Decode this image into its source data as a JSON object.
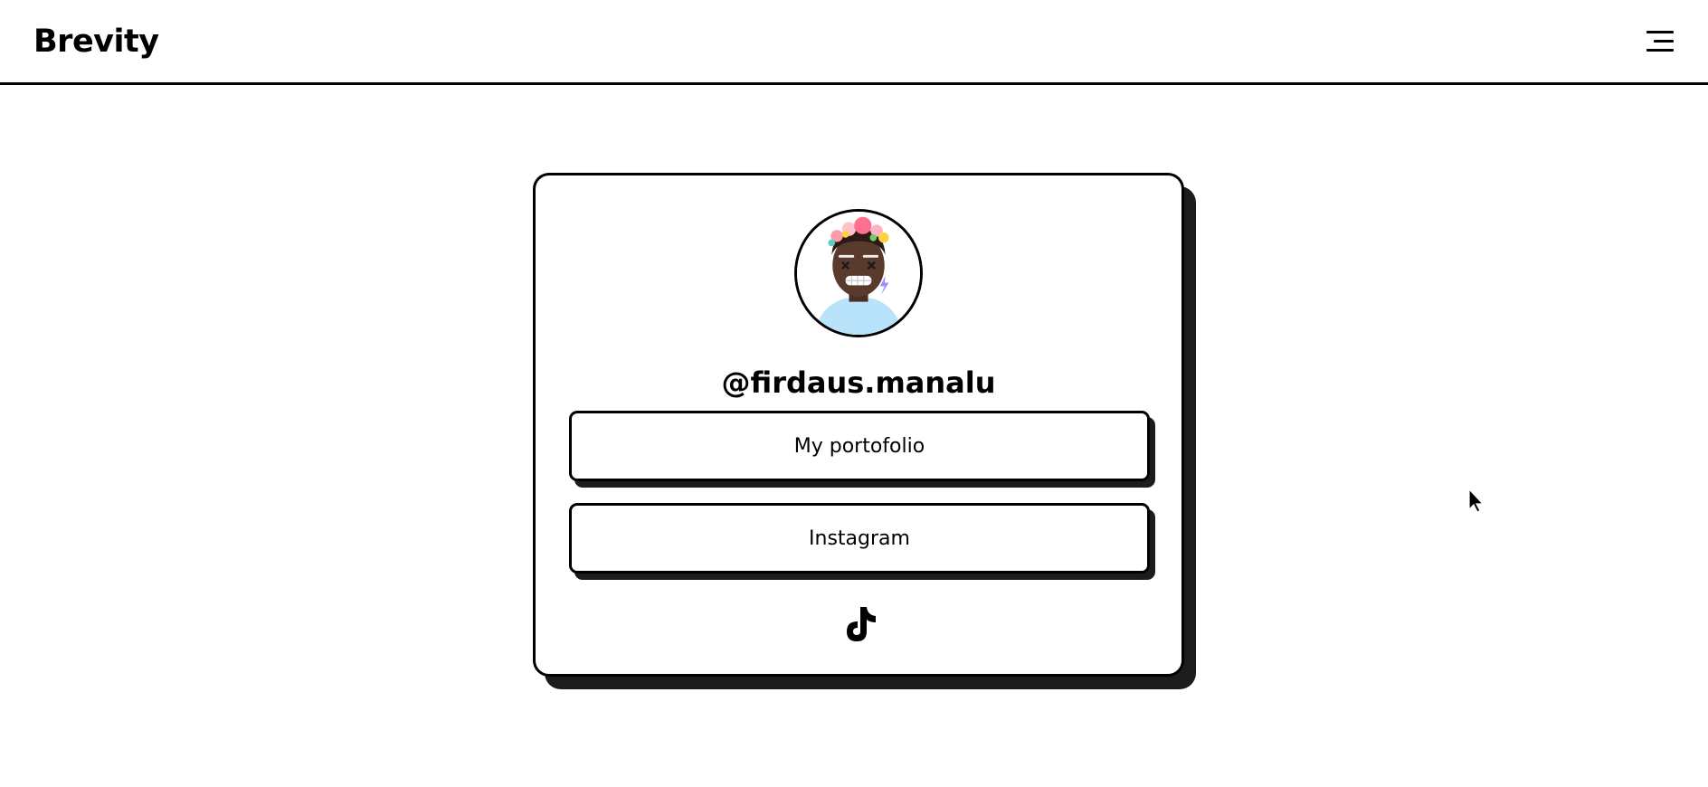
{
  "navbar": {
    "brand": "Brevity",
    "menu_icon": "hamburger-menu-icon"
  },
  "profile": {
    "avatar_icon": "profile-avatar",
    "username": "@firdaus.manalu"
  },
  "links": [
    {
      "label": "My portofolio"
    },
    {
      "label": "Instagram"
    }
  ],
  "social": {
    "tiktok_icon": "tiktok-icon"
  },
  "colors": {
    "background": "#ffffff",
    "border": "#000000",
    "shadow": "#1c1c1c",
    "avatar_skin": "#5a3a2c",
    "avatar_shirt": "#b8e3fb"
  }
}
